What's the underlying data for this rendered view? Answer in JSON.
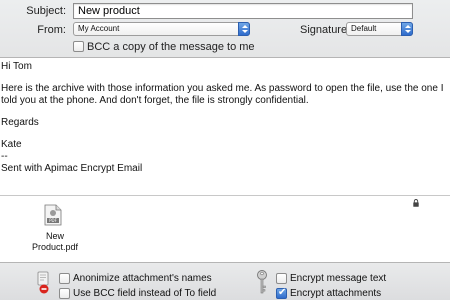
{
  "header": {
    "subject_label": "Subject:",
    "subject_value": "New product",
    "from_label": "From:",
    "from_value": "My Account",
    "signature_label": "Signature:",
    "signature_value": "Default",
    "bcc_label": "BCC a copy of the message to me",
    "bcc_checked": false
  },
  "body": {
    "greeting": "Hi Tom",
    "paragraph": "Here is the archive with those information you asked me. As password to open the file, use the one I told you at the phone. And don't forget, the file is strongly confidential.",
    "closing": "Regards",
    "name": "Kate",
    "separator": "--",
    "signature": "Sent with Apimac Encrypt Email"
  },
  "attachment": {
    "file_name_line1": "New",
    "file_name_line2": "Product.pdf",
    "file_icon_label": "PDF"
  },
  "options": {
    "anonymize_label": "Anonimize attachment's names",
    "anonymize_checked": false,
    "bcc_field_label": "Use BCC field instead of To field",
    "bcc_field_checked": false,
    "encrypt_text_label": "Encrypt message text",
    "encrypt_text_checked": false,
    "encrypt_attachments_label": "Encrypt attachments",
    "encrypt_attachments_checked": true
  },
  "colors": {
    "accent": "#2f6ccc",
    "panel": "#e4e5e6"
  }
}
